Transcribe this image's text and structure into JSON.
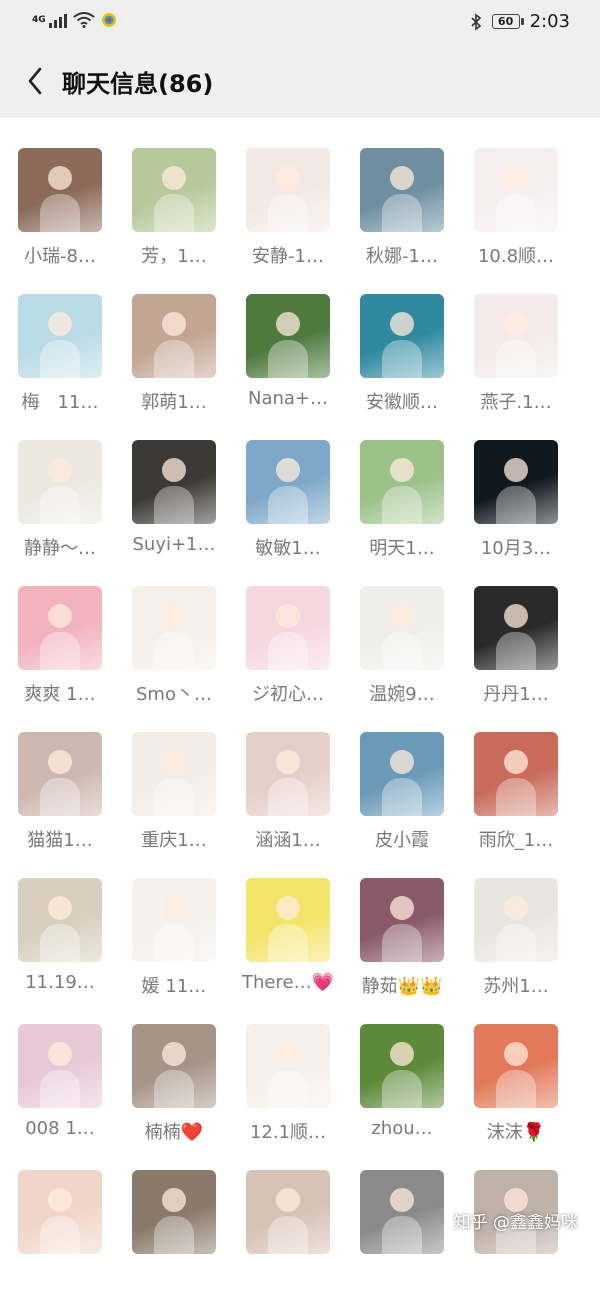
{
  "status_bar": {
    "network": "4G",
    "battery": "60",
    "time": "2:03"
  },
  "header": {
    "title": "聊天信息(86)"
  },
  "members": [
    {
      "name": "小瑞-8…",
      "color": "#8b6a5a"
    },
    {
      "name": "芳，1…",
      "color": "#b7c99a"
    },
    {
      "name": "安静-1…",
      "color": "#f3e9e4"
    },
    {
      "name": "秋娜-1…",
      "color": "#6f8fa0"
    },
    {
      "name": "10.8顺…",
      "color": "#f7eef0"
    },
    {
      "name": "梅　11…",
      "color": "#b9dbe6"
    },
    {
      "name": "郭萌1…",
      "color": "#c2a592"
    },
    {
      "name": "Nana+…",
      "color": "#4e7a3e"
    },
    {
      "name": "安徽顺…",
      "color": "#2f8aa0"
    },
    {
      "name": "燕子.1…",
      "color": "#f4eaea"
    },
    {
      "name": "静静～…",
      "color": "#ece8e0"
    },
    {
      "name": "Suyi+1…",
      "color": "#3c3a36"
    },
    {
      "name": "敏敏1…",
      "color": "#7fa8c8"
    },
    {
      "name": "明天1…",
      "color": "#9cc28a"
    },
    {
      "name": "10月3…",
      "color": "#101820"
    },
    {
      "name": "爽爽 1…",
      "color": "#f2b3bf"
    },
    {
      "name": "Smo丶…",
      "color": "#f5efe9"
    },
    {
      "name": "ジ初心…",
      "color": "#f6d7e0"
    },
    {
      "name": "温婉9…",
      "color": "#eeeeea"
    },
    {
      "name": "丹丹1…",
      "color": "#2a2a2a"
    },
    {
      "name": "猫猫1…",
      "color": "#cdb7b0"
    },
    {
      "name": "重庆1…",
      "color": "#f4ece6"
    },
    {
      "name": "涵涵1…",
      "color": "#e6cfc8"
    },
    {
      "name": "皮小霞",
      "color": "#6a9ab8"
    },
    {
      "name": "雨欣_1…",
      "color": "#c86b5a"
    },
    {
      "name": "11.19…",
      "color": "#d9cfbf"
    },
    {
      "name": "媛 11…",
      "color": "#f4f1ee"
    },
    {
      "name": "There…💗",
      "color": "#f4e46a"
    },
    {
      "name": "静茹👑👑",
      "color": "#8a5a6a"
    },
    {
      "name": "苏州1…",
      "color": "#e9e6e2"
    },
    {
      "name": "008 1…",
      "color": "#e8c9d8"
    },
    {
      "name": "楠楠❤️",
      "color": "#a79488"
    },
    {
      "name": "12.1顺…",
      "color": "#f5f0ec"
    },
    {
      "name": "zhou…",
      "color": "#5d8a3a"
    },
    {
      "name": "沫沫🌹",
      "color": "#e27a5a"
    },
    {
      "name": "",
      "color": "#f0d6c8"
    },
    {
      "name": "",
      "color": "#8a7a6a"
    },
    {
      "name": "",
      "color": "#d7c2b6"
    },
    {
      "name": "",
      "color": "#8a8a8a"
    },
    {
      "name": "",
      "color": "#bfb0a8"
    }
  ],
  "watermark": "知乎 @鑫鑫妈咪"
}
